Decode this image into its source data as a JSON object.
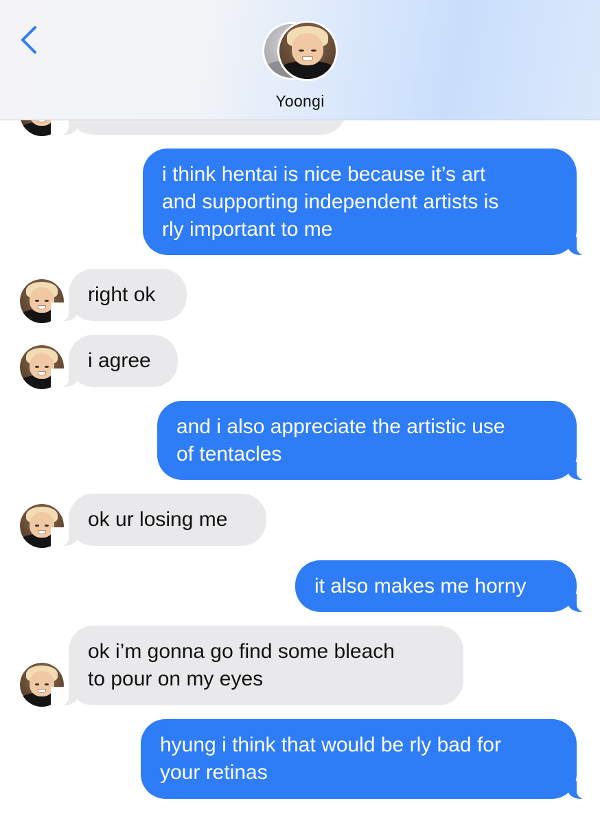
{
  "header": {
    "contact_name": "Yoongi",
    "back_icon": "chevron-left-icon",
    "accent_color": "#2e7cf6"
  },
  "messages": [
    {
      "direction": "incoming",
      "text": ""
    },
    {
      "direction": "outgoing",
      "lines": [
        "i think hentai is nice because it’s art",
        "and supporting independent artists is",
        "rly important to me"
      ]
    },
    {
      "direction": "incoming",
      "lines": [
        "right ok"
      ]
    },
    {
      "direction": "incoming",
      "lines": [
        "i agree"
      ]
    },
    {
      "direction": "outgoing",
      "lines": [
        "and i also appreciate the artistic use",
        "of tentacles"
      ]
    },
    {
      "direction": "incoming",
      "lines": [
        "ok ur losing me"
      ]
    },
    {
      "direction": "outgoing",
      "lines": [
        "it also makes me horny"
      ]
    },
    {
      "direction": "incoming",
      "lines": [
        "ok i’m gonna go find some bleach",
        "to pour on my eyes"
      ]
    },
    {
      "direction": "outgoing",
      "lines": [
        "hyung i think that would be rly bad for",
        "your retinas"
      ]
    }
  ],
  "colors": {
    "outgoing_bubble": "#2e7cf6",
    "incoming_bubble": "#e9e9eb"
  }
}
